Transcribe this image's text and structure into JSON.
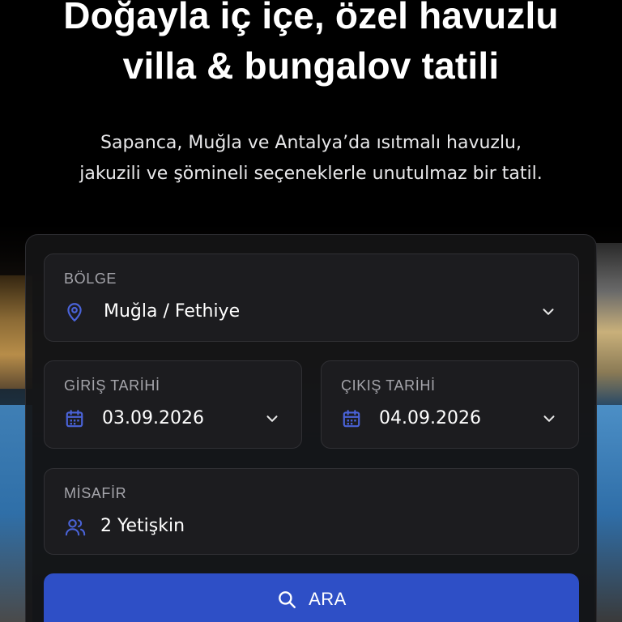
{
  "hero": {
    "title_line1": "Doğayla iç içe, özel havuzlu",
    "title_line2": "villa & bungalov tatili",
    "subtitle_line1": "Sapanca, Muğla ve Antalya’da ısıtmalı havuzlu,",
    "subtitle_line2": "jakuzili ve şömineli seçeneklerle unutulmaz bir tatil."
  },
  "search_form": {
    "region": {
      "label": "BÖLGE",
      "value": "Muğla / Fethiye",
      "icon": "location-pin-icon"
    },
    "checkin": {
      "label": "GİRİŞ TARİHİ",
      "value": "03.09.2026",
      "icon": "calendar-icon"
    },
    "checkout": {
      "label": "ÇIKIŞ TARİHİ",
      "value": "04.09.2026",
      "icon": "calendar-icon"
    },
    "guests": {
      "label": "MİSAFİR",
      "value": "2 Yetişkin",
      "icon": "users-icon"
    },
    "search_button": {
      "label": "ARA",
      "icon": "search-icon"
    }
  },
  "colors": {
    "accent": "#2e4fc6",
    "icon_blue": "#4a63d8",
    "card_bg": "#141416",
    "field_bg": "#1c1c1f"
  }
}
